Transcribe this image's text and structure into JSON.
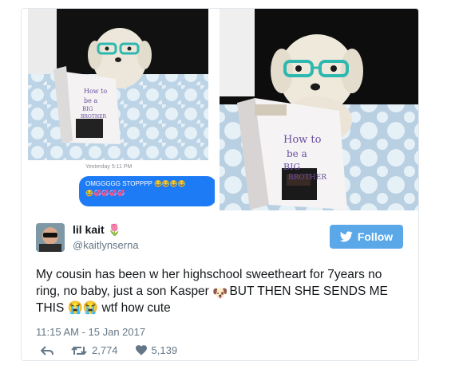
{
  "media": {
    "left_image": {
      "timestamp": "Yesterday 5:11 PM",
      "message": "OMGGGGG STOPPPP"
    },
    "book_text": [
      "How to",
      "be a",
      "BIG",
      "BROTHER"
    ]
  },
  "tweet": {
    "display_name": "lil kait",
    "handle": "@kaitlynserna",
    "follow_label": "Follow",
    "text_part1": "My cousin has been w her highschool sweetheart for 7years no ring, no baby, just a son Kasper",
    "text_part2": "BUT THEN SHE SENDS ME THIS",
    "text_part3": "wtf how cute",
    "timestamp": "11:15 AM - 15 Jan 2017",
    "retweets": "2,774",
    "likes": "5,139"
  },
  "colors": {
    "follow_button": "#5aa8e8",
    "imessage_blue": "#1e7bf6",
    "text_primary": "#14171a",
    "text_secondary": "#657786"
  }
}
